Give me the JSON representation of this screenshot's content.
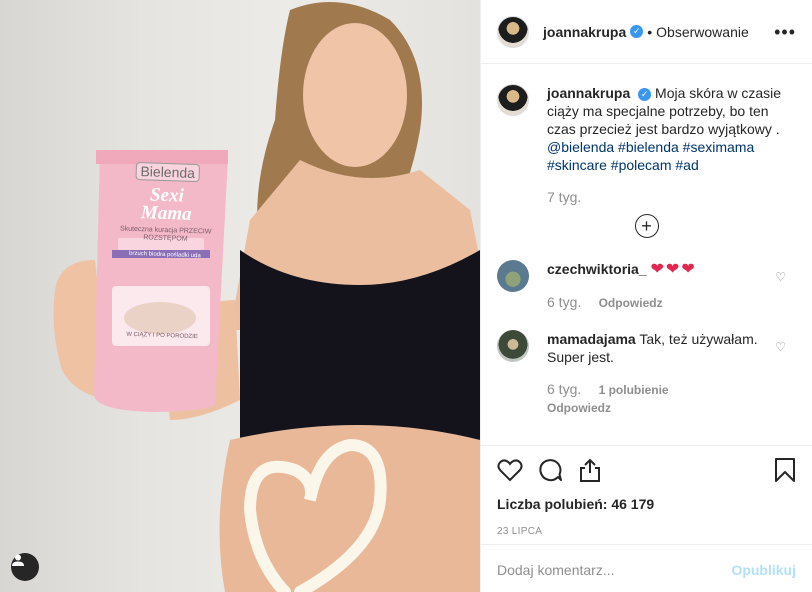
{
  "post": {
    "author": "joannakrupa",
    "follow_label": "Obserwowanie",
    "more_glyph": "•••"
  },
  "caption": {
    "username": "joannakrupa",
    "text": "Moja skóra w czasie ciąży ma specjalne potrzeby, bo ten czas przecież jest bardzo wyjątkowy .",
    "tags": "@bielenda #bielenda #seximama #skincare #polecam #ad",
    "time": "7 tyg."
  },
  "load_more_glyph": "+",
  "comments": [
    {
      "username": "czechwiktoria_",
      "text": "❤❤❤",
      "time": "6 tyg.",
      "reply": "Odpowiedz",
      "likes": ""
    },
    {
      "username": "mamadajama",
      "text": "Tak, też używałam. Super jest.",
      "time": "6 tyg.",
      "likes": "1 polubienie",
      "reply": "Odpowiedz"
    }
  ],
  "likes_text": "Liczba polubień: 46 179",
  "date": "23 LIPCA",
  "add_comment": {
    "placeholder": "Dodaj komentarz...",
    "publish": "Opublikuj"
  },
  "product": {
    "brand": "Bielenda",
    "line1": "Sexi",
    "line2": "Mama",
    "desc": "Skuteczna kuracja PRZECIW ROZSTĘPOM",
    "sub": "brzuch biodra pośladki uda",
    "footer": "W CIĄŻY I PO PORODZIE"
  },
  "colors": {
    "verified": "#3897f0",
    "heart": "#e2264d",
    "publish": "#b2dffc",
    "tube": "#f4b9c8"
  },
  "icons": [
    "heart-icon",
    "comment-icon",
    "share-icon",
    "bookmark-icon",
    "verified-badge-icon",
    "more-options-icon",
    "user-tag-icon",
    "plus-circle-icon"
  ]
}
